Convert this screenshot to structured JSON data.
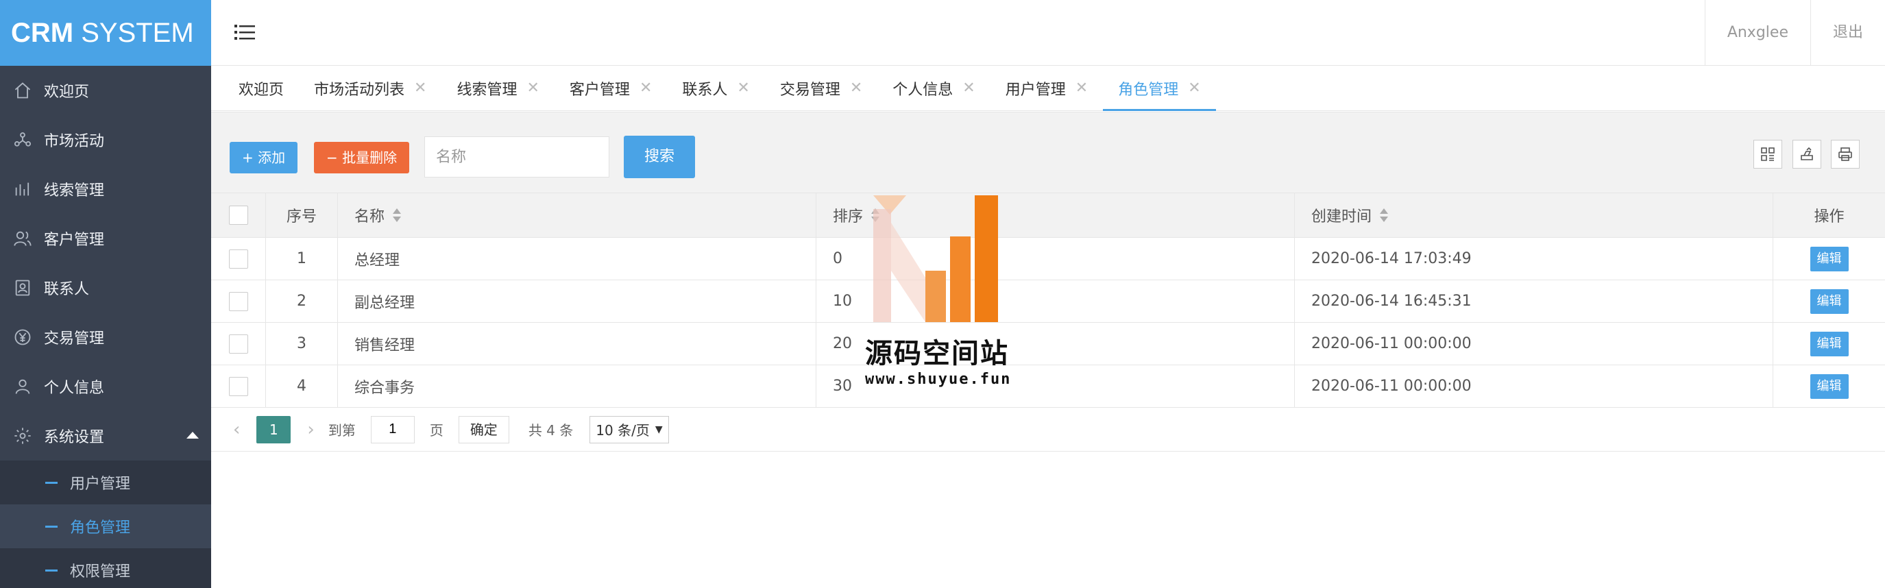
{
  "app": {
    "title_bold": "CRM",
    "title_rest": " SYSTEM"
  },
  "sidebar": {
    "items": [
      {
        "label": "欢迎页",
        "icon": "home-icon"
      },
      {
        "label": "市场活动",
        "icon": "people-network-icon"
      },
      {
        "label": "线索管理",
        "icon": "leads-icon"
      },
      {
        "label": "客户管理",
        "icon": "customers-icon"
      },
      {
        "label": "联系人",
        "icon": "contact-card-icon"
      },
      {
        "label": "交易管理",
        "icon": "yuan-coin-icon"
      },
      {
        "label": "个人信息",
        "icon": "user-icon"
      },
      {
        "label": "系统设置",
        "icon": "gear-icon"
      }
    ],
    "submenu": [
      {
        "label": "用户管理"
      },
      {
        "label": "角色管理",
        "active": true
      },
      {
        "label": "权限管理"
      }
    ]
  },
  "header": {
    "user": "Anxglee",
    "logout": "退出"
  },
  "tabs": [
    {
      "label": "欢迎页"
    },
    {
      "label": "市场活动列表",
      "close": "✕"
    },
    {
      "label": "线索管理",
      "close": "✕"
    },
    {
      "label": "客户管理",
      "close": "✕"
    },
    {
      "label": "联系人",
      "close": "✕"
    },
    {
      "label": "交易管理",
      "close": "✕"
    },
    {
      "label": "个人信息",
      "close": "✕"
    },
    {
      "label": "用户管理",
      "close": "✕"
    },
    {
      "label": "角色管理",
      "close": "✕",
      "active": true
    }
  ],
  "toolbar": {
    "add_label": "+ 添加",
    "batch_delete_label": "− 批量删除",
    "search_placeholder": "名称",
    "search_label": "搜索"
  },
  "table": {
    "columns": {
      "index": "序号",
      "name": "名称",
      "sort": "排序",
      "created": "创建时间",
      "ops": "操作"
    },
    "rows": [
      {
        "index": "1",
        "name": "总经理",
        "sort": "0",
        "created": "2020-06-14 17:03:49",
        "edit": "编辑"
      },
      {
        "index": "2",
        "name": "副总经理",
        "sort": "10",
        "created": "2020-06-14 16:45:31",
        "edit": "编辑"
      },
      {
        "index": "3",
        "name": "销售经理",
        "sort": "20",
        "created": "2020-06-11 00:00:00",
        "edit": "编辑"
      },
      {
        "index": "4",
        "name": "综合事务",
        "sort": "30",
        "created": "2020-06-11 00:00:00",
        "edit": "编辑"
      }
    ]
  },
  "pager": {
    "current": "1",
    "goto_label": "到第",
    "page_value": "1",
    "page_unit": "页",
    "confirm": "确定",
    "total": "共 4 条",
    "page_size": "10 条/页"
  },
  "watermark": {
    "text": "源码空间站",
    "url": "www.shuyue.fun"
  },
  "colors": {
    "accent": "#4aa3e6",
    "danger": "#ee6a3a",
    "sidebar": "#394150",
    "pager_active": "#3d8f88"
  }
}
